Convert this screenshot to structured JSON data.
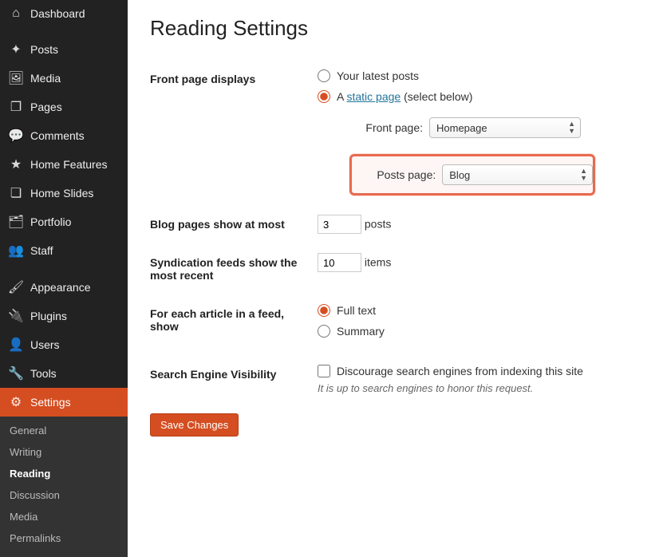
{
  "sidebar": {
    "groups": [
      [
        {
          "icon": "⌂",
          "label": "Dashboard",
          "name": "dashboard"
        }
      ],
      [
        {
          "icon": "✦",
          "label": "Posts",
          "name": "posts"
        },
        {
          "icon": "🖼",
          "label": "Media",
          "name": "media"
        },
        {
          "icon": "❐",
          "label": "Pages",
          "name": "pages"
        },
        {
          "icon": "💬",
          "label": "Comments",
          "name": "comments"
        },
        {
          "icon": "★",
          "label": "Home Features",
          "name": "home-features"
        },
        {
          "icon": "❏",
          "label": "Home Slides",
          "name": "home-slides"
        },
        {
          "icon": "🗂",
          "label": "Portfolio",
          "name": "portfolio"
        },
        {
          "icon": "👥",
          "label": "Staff",
          "name": "staff"
        }
      ],
      [
        {
          "icon": "🖌",
          "label": "Appearance",
          "name": "appearance"
        },
        {
          "icon": "🔌",
          "label": "Plugins",
          "name": "plugins"
        },
        {
          "icon": "👤",
          "label": "Users",
          "name": "users"
        },
        {
          "icon": "🔧",
          "label": "Tools",
          "name": "tools"
        },
        {
          "icon": "⚙",
          "label": "Settings",
          "name": "settings",
          "active": true
        }
      ]
    ],
    "settings_sub": [
      {
        "label": "General",
        "name": "general"
      },
      {
        "label": "Writing",
        "name": "writing"
      },
      {
        "label": "Reading",
        "name": "reading",
        "current": true
      },
      {
        "label": "Discussion",
        "name": "discussion"
      },
      {
        "label": "Media",
        "name": "media-settings"
      },
      {
        "label": "Permalinks",
        "name": "permalinks"
      }
    ]
  },
  "page": {
    "title": "Reading Settings",
    "front_page": {
      "heading": "Front page displays",
      "opt_latest": "Your latest posts",
      "opt_static_prefix": "A ",
      "opt_static_link": "static page",
      "opt_static_suffix": " (select below)",
      "selected": "static",
      "front_label": "Front page:",
      "front_value": "Homepage",
      "posts_label": "Posts page:",
      "posts_value": "Blog"
    },
    "blog_pages": {
      "heading": "Blog pages show at most",
      "value": "3",
      "unit": "posts"
    },
    "syndication": {
      "heading": "Syndication feeds show the most recent",
      "value": "10",
      "unit": "items"
    },
    "article_feed": {
      "heading": "For each article in a feed, show",
      "opt_full": "Full text",
      "opt_summary": "Summary",
      "selected": "full"
    },
    "seo": {
      "heading": "Search Engine Visibility",
      "checkbox_label": "Discourage search engines from indexing this site",
      "note": "It is up to search engines to honor this request."
    },
    "save_label": "Save Changes"
  }
}
